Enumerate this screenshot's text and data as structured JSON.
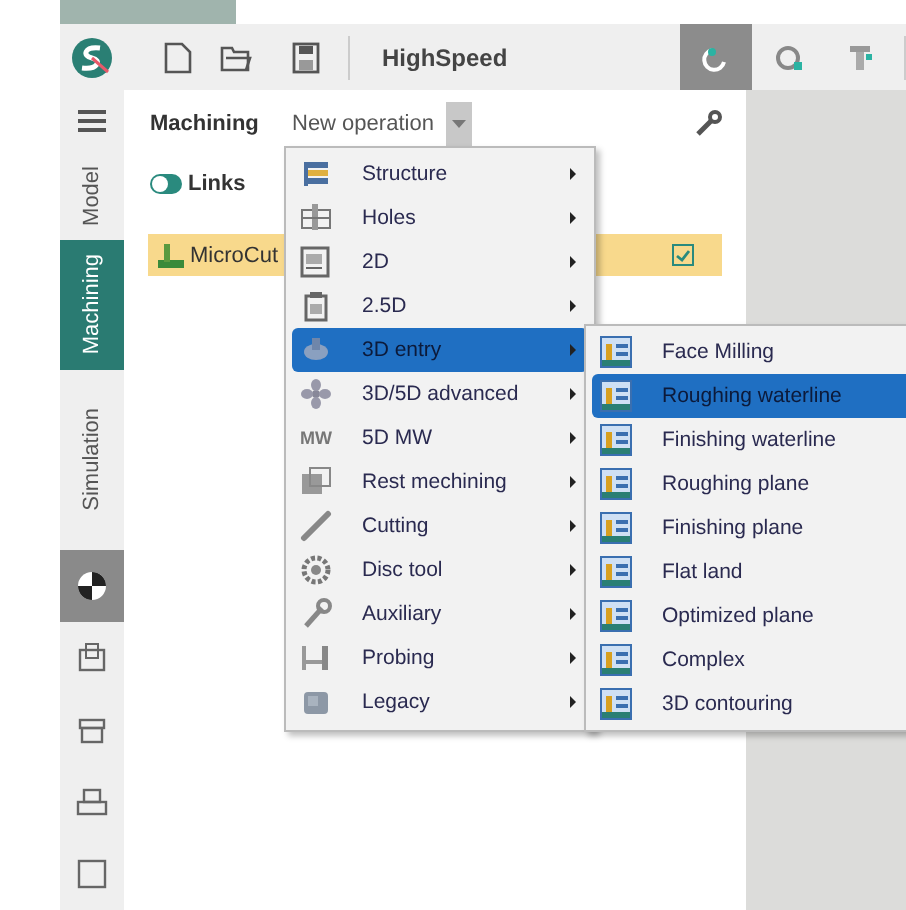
{
  "toolbar": {
    "title": "HighSpeed",
    "tools": [
      {
        "selected": true
      },
      {
        "selected": false
      },
      {
        "selected": false
      }
    ]
  },
  "sidebar": {
    "tabs": [
      {
        "label": "Model",
        "selected": false
      },
      {
        "label": "Machining",
        "selected": true
      },
      {
        "label": "Simulation",
        "selected": false
      }
    ],
    "tools": [
      {
        "selected": true
      },
      {
        "selected": false
      },
      {
        "selected": false
      },
      {
        "selected": false
      },
      {
        "selected": false
      }
    ]
  },
  "panel": {
    "title": "Machining",
    "operation_select": {
      "value": "New operation"
    },
    "links_toggle": {
      "label": "Links",
      "on": true
    },
    "rows": [
      {
        "name": "MicroCut",
        "selected": true,
        "checked": true
      }
    ]
  },
  "menu": {
    "items": [
      {
        "label": "Structure",
        "selected": false
      },
      {
        "label": "Holes",
        "selected": false
      },
      {
        "label": "2D",
        "selected": false
      },
      {
        "label": "2.5D",
        "selected": false
      },
      {
        "label": "3D entry",
        "selected": true
      },
      {
        "label": "3D/5D advanced",
        "selected": false
      },
      {
        "label": "5D MW",
        "selected": false,
        "icon_text": "MW"
      },
      {
        "label": "Rest mechining",
        "selected": false
      },
      {
        "label": "Cutting",
        "selected": false
      },
      {
        "label": "Disc tool",
        "selected": false
      },
      {
        "label": "Auxiliary",
        "selected": false
      },
      {
        "label": "Probing",
        "selected": false
      },
      {
        "label": "Legacy",
        "selected": false
      }
    ]
  },
  "submenu": {
    "items": [
      {
        "label": "Face Milling",
        "selected": false
      },
      {
        "label": "Roughing waterline",
        "selected": true
      },
      {
        "label": "Finishing waterline",
        "selected": false
      },
      {
        "label": "Roughing plane",
        "selected": false
      },
      {
        "label": "Finishing plane",
        "selected": false
      },
      {
        "label": "Flat land",
        "selected": false
      },
      {
        "label": "Optimized plane",
        "selected": false
      },
      {
        "label": "Complex",
        "selected": false
      },
      {
        "label": "3D contouring",
        "selected": false
      }
    ]
  }
}
